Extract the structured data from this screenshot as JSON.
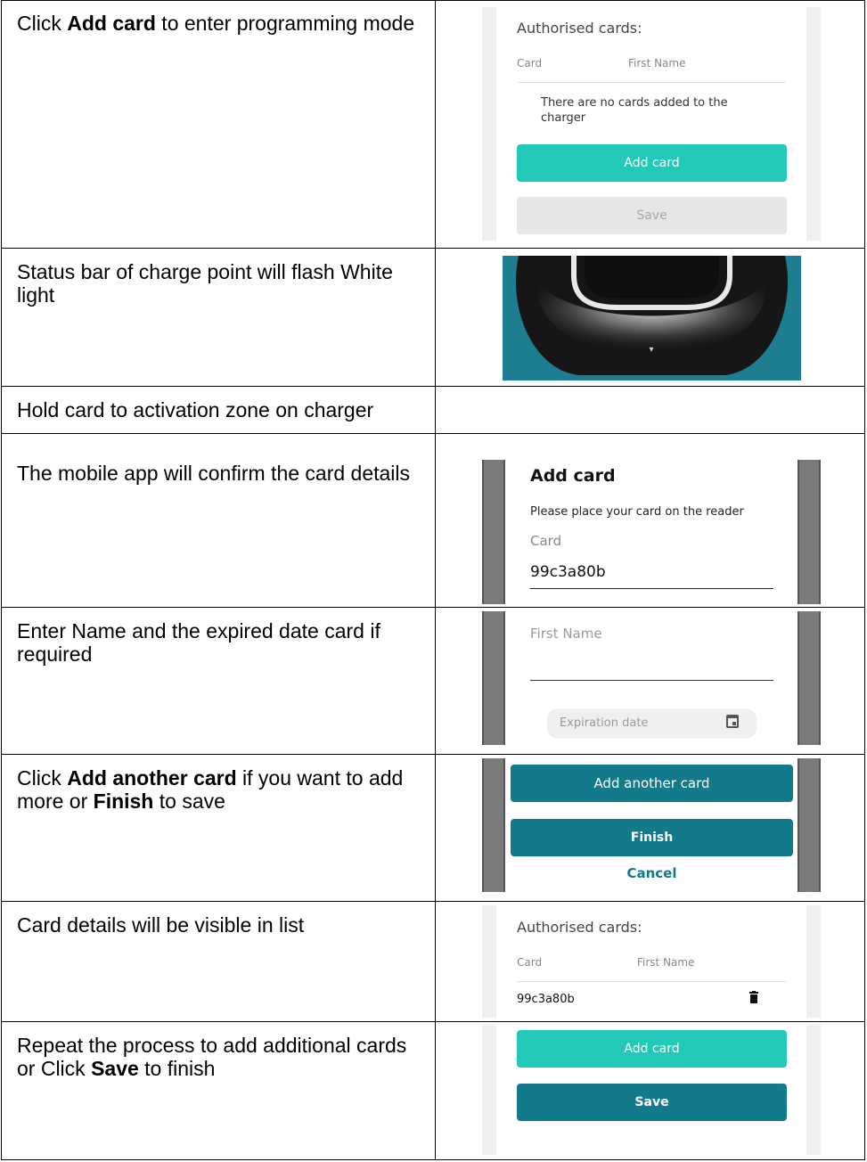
{
  "steps": [
    {
      "parts": [
        "Click ",
        "Add card",
        " to enter programming mode"
      ]
    },
    {
      "text": "Status bar of charge point will flash White light"
    },
    {
      "text": "Hold card to activation zone on charger"
    },
    {
      "text": "The mobile app will confirm the card details"
    },
    {
      "text": "Enter Name and the expired date card if required"
    },
    {
      "parts": [
        "Click ",
        "Add another card",
        " if you want to add more or ",
        "Finish",
        " to save"
      ]
    },
    {
      "text": "Card details will be visible in list"
    },
    {
      "parts": [
        "Repeat the process to add additional cards or Click ",
        "Save",
        " to finish"
      ]
    }
  ],
  "panel1": {
    "heading": "Authorised cards:",
    "col_card": "Card",
    "col_name": "First Name",
    "empty_message": "There are no cards added to the charger",
    "add_button": "Add card",
    "save_button": "Save"
  },
  "panel4": {
    "title": "Add card",
    "instruction": "Please place your card on the reader",
    "field_label": "Card",
    "field_value": "99c3a80b"
  },
  "panel5": {
    "name_placeholder": "First Name",
    "date_placeholder": "Expiration date",
    "calendar_icon": "calendar-icon"
  },
  "panel6": {
    "add_another_button": "Add another card",
    "finish_button": "Finish",
    "cancel_link": "Cancel"
  },
  "panel7": {
    "heading": "Authorised cards:",
    "col_card": "Card",
    "col_name": "First Name",
    "card_id": "99c3a80b",
    "delete_icon": "trash-icon"
  },
  "panel8": {
    "add_button": "Add card",
    "save_button": "Save"
  },
  "colors": {
    "teal_light": "#22c8b8",
    "teal_dark": "#137a8b",
    "disabled_gray": "#e4e6e8",
    "charger_bg": "#1c7e90"
  }
}
